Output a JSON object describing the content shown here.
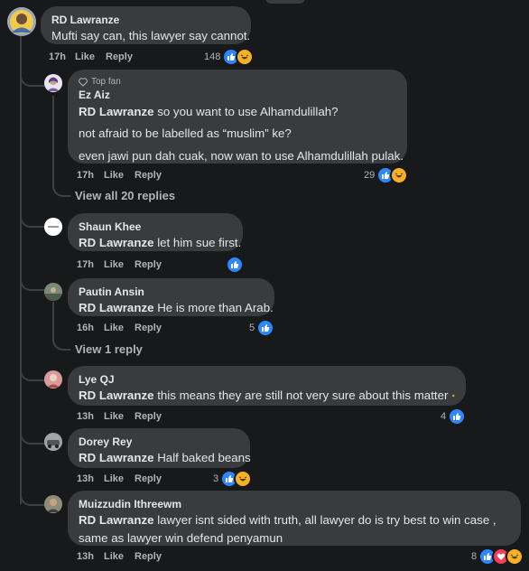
{
  "actions": {
    "like": "Like",
    "reply": "Reply"
  },
  "main": {
    "author": "RD Lawranze",
    "text": "Mufti say can, this lawyer say cannot.",
    "time": "17h",
    "count": "148"
  },
  "reply_ez": {
    "badge": "Top fan",
    "author": "Ez Aiz",
    "tag": "RD Lawranze",
    "line1": " so you want to use Alhamdulillah?",
    "line2": "not afraid to be labelled as “muslim” ke?",
    "line3": "even jawi pun dah cuak, now wan to use Alhamdulillah pulak.",
    "time": "17h",
    "count": "29",
    "view_replies": "View all 20 replies"
  },
  "comments": [
    {
      "author": "Shaun Khee",
      "tag": "RD Lawranze",
      "text": " let him sue first.",
      "time": "17h",
      "count": ""
    },
    {
      "author": "Pautin Ansin",
      "tag": "RD Lawranze",
      "text": " He is more than Arab.",
      "time": "16h",
      "count": "5",
      "view_replies": "View 1 reply"
    },
    {
      "author": "Lye QJ",
      "tag": "RD Lawranze",
      "text": " this means they are still not very sure about this matter",
      "time": "13h",
      "count": "4"
    },
    {
      "author": "Dorey Rey",
      "tag": "RD Lawranze",
      "text": " Half baked beans",
      "time": "13h",
      "count": "3"
    },
    {
      "author": "Muizzudin Ithreewm",
      "tag": "RD Lawranze",
      "text": " lawyer isnt sided with truth, all lawyer do is try best to win case ,",
      "text2": "same as lawyer win defend penyamun",
      "time": "13h",
      "count": "8"
    }
  ],
  "colors": {
    "bg": "#18191a",
    "bubble": "#3a3b3c",
    "like": "#2d88ff",
    "haha": "#f7b125",
    "love": "#f33e58"
  }
}
